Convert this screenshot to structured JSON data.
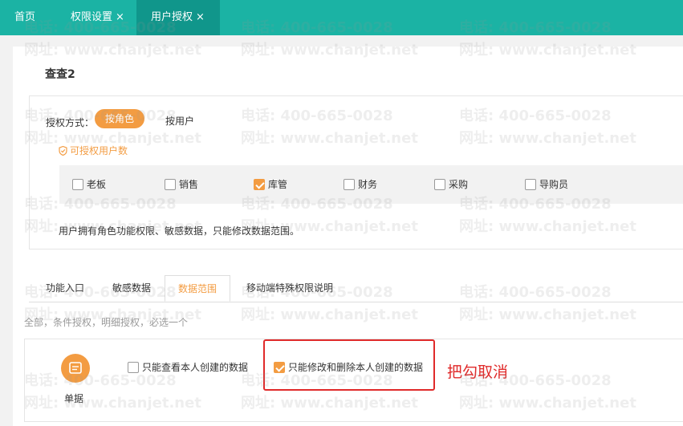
{
  "tabs": {
    "home": "首页",
    "permission_settings": "权限设置",
    "user_auth": "用户授权",
    "close_glyph": "×"
  },
  "user_name": "查查2",
  "auth": {
    "method_label": "授权方式：",
    "by_role": "按角色",
    "by_user": "按用户",
    "license_hint": "可授权用户数",
    "roles": [
      {
        "label": "老板",
        "checked": false
      },
      {
        "label": "销售",
        "checked": false
      },
      {
        "label": "库管",
        "checked": true
      },
      {
        "label": "财务",
        "checked": false
      },
      {
        "label": "采购",
        "checked": false
      },
      {
        "label": "导购员",
        "checked": false
      }
    ],
    "note": "用户拥有角色功能权限、敏感数据，只能修改数据范围。"
  },
  "subtabs": [
    "功能入口",
    "敏感数据",
    "数据范围",
    "移动端特殊权限说明"
  ],
  "active_subtab": "数据范围",
  "scope_hint": "全部，条件授权，明细授权，必选一个",
  "scope": {
    "doc_label": "单据",
    "opt_view_own": {
      "label": "只能查看本人创建的数据",
      "checked": false
    },
    "opt_edit_own": {
      "label": "只能修改和删除本人创建的数据",
      "checked": true
    }
  },
  "annotation": "把勾取消",
  "watermark": {
    "phone": "电话: 400-665-0028",
    "site": "网址: www.chanjet.net"
  },
  "colors": {
    "topbar": "#1bb3a4",
    "accent": "#f39c42",
    "annotation": "#e02a2a"
  }
}
